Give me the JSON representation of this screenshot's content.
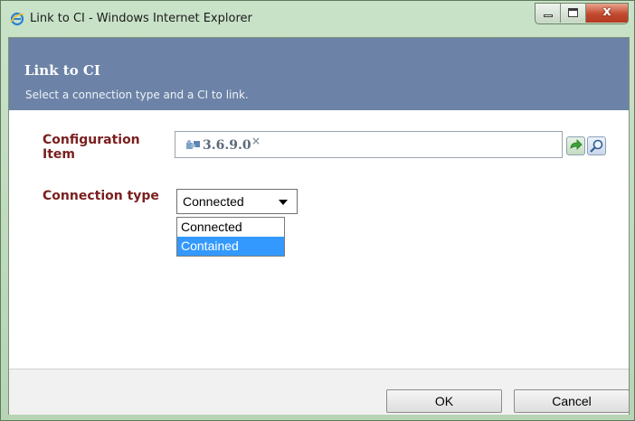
{
  "window": {
    "title": "Link to CI - Windows Internet Explorer",
    "close_glyph": "x",
    "icons": [
      "ie-icon",
      "minimize-icon",
      "maximize-icon",
      "close-icon"
    ]
  },
  "dialog": {
    "title": "Link to CI",
    "subtitle": "Select a connection type and a CI to link."
  },
  "form": {
    "configuration_item": {
      "label": "Configuration Item",
      "value": "3.6.9.0",
      "remove_glyph": "×",
      "icons": [
        "ci-puzzle-icon",
        "go-arrow-icon",
        "lookup-magnifier-icon"
      ]
    },
    "connection_type": {
      "label": "Connection type",
      "selected": "Connected",
      "options": [
        {
          "label": "Connected",
          "highlighted": false
        },
        {
          "label": "Contained",
          "highlighted": true
        }
      ]
    }
  },
  "buttons": {
    "ok": "OK",
    "cancel": "Cancel"
  },
  "colors": {
    "header_bg": "#6c83a7",
    "label_text": "#7a1f1f",
    "highlight": "#3399ff",
    "window_frame": "#b7d4b5"
  }
}
